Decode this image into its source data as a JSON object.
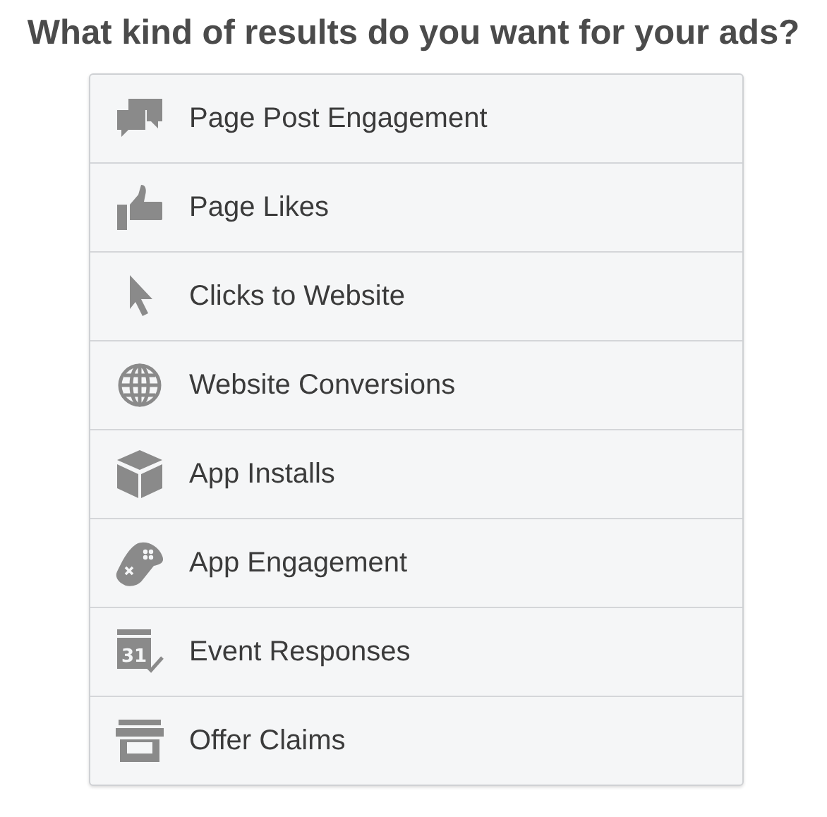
{
  "title": "What kind of results do you want for your ads?",
  "options": [
    {
      "label": "Page Post Engagement",
      "kind": "chat"
    },
    {
      "label": "Page Likes",
      "kind": "thumb"
    },
    {
      "label": "Clicks to Website",
      "kind": "cursor"
    },
    {
      "label": "Website Conversions",
      "kind": "globe"
    },
    {
      "label": "App Installs",
      "kind": "box"
    },
    {
      "label": "App Engagement",
      "kind": "gamepad"
    },
    {
      "label": "Event Responses",
      "kind": "calendar",
      "icon_text": "31"
    },
    {
      "label": "Offer Claims",
      "kind": "store"
    }
  ]
}
